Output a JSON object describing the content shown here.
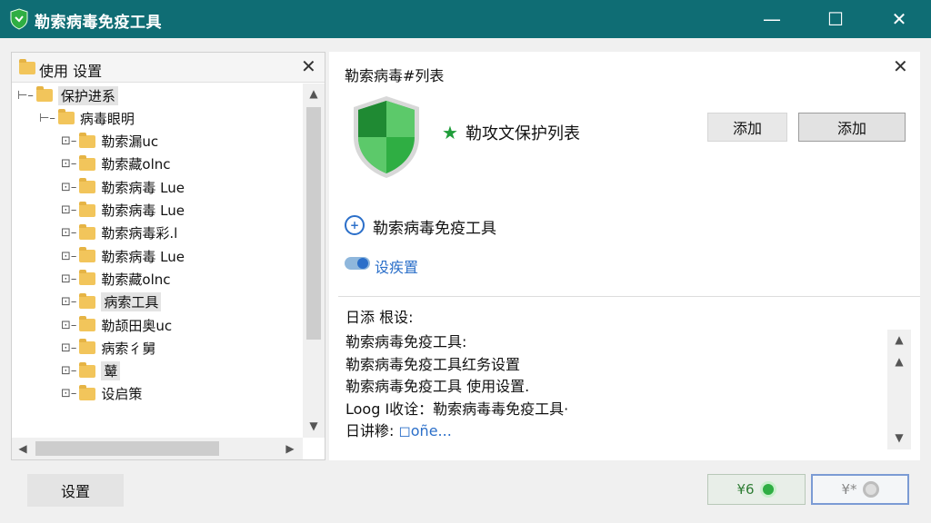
{
  "window": {
    "title": "勒索病毒免疫工具",
    "minimize": "—",
    "maximize": "☐",
    "close": "✕"
  },
  "left_panel": {
    "title": "使用  设置",
    "close": "✕",
    "tree": [
      {
        "prefix": "⊢–",
        "label": "保护进系",
        "selected": true
      },
      {
        "prefix": "⊢–",
        "label": "病毒眼明",
        "selected": false
      },
      {
        "prefix": "⊡–",
        "label": "勒索漏uc",
        "selected": false
      },
      {
        "prefix": "⊡–",
        "label": "勒索藏olnc",
        "selected": false
      },
      {
        "prefix": "⊡–",
        "label": "勒索病毒 Lue",
        "selected": false
      },
      {
        "prefix": "⊡–",
        "label": "勒索病毒 Lue",
        "selected": false
      },
      {
        "prefix": "⊡–",
        "label": "勒索病毒彩.l",
        "selected": false
      },
      {
        "prefix": "⊡–",
        "label": "勒索病毒 Lue",
        "selected": false
      },
      {
        "prefix": "⊡–",
        "label": "勒索藏olnc",
        "selected": false
      },
      {
        "prefix": "⊡–",
        "label": "病索工具",
        "selected": true
      },
      {
        "prefix": "⊡–",
        "label": "勒颉田奥uc",
        "selected": false
      },
      {
        "prefix": "⊡–",
        "label": "病索彳舅",
        "selected": false
      },
      {
        "prefix": "⊡–",
        "label": "鼙",
        "selected": true
      },
      {
        "prefix": "⊡–",
        "label": "设启策",
        "selected": false
      }
    ]
  },
  "right_panel": {
    "title": "勒索病毒#列表",
    "close": "✕",
    "list_label": "勒攻文保护列表",
    "add_button_1": "添加",
    "add_button_2": "添加",
    "tool_label": "勒索病毒免疫工具",
    "toggle_label": "设疾置",
    "log_header": "日添 根设:",
    "log_lines": [
      {
        "text": "勒索病毒免疫工具:",
        "link": ""
      },
      {
        "text": "勒索病毒免疫工具红务设置",
        "link": ""
      },
      {
        "text": "勒索病毒免疫工具 使用设置.",
        "link": ""
      },
      {
        "text": "Loog I收诠：勒索病毒毒免疫工具·",
        "link": ""
      },
      {
        "text": "日讲糁: ",
        "link": "◻oñe..."
      }
    ]
  },
  "bottom": {
    "settings_button": "设置",
    "status_button_1": "¥6",
    "status_button_2": "¥*"
  },
  "colors": {
    "titlebar": "#0f6d74",
    "accent_blue": "#2b6fc9",
    "shield_green": "#2fae43"
  }
}
